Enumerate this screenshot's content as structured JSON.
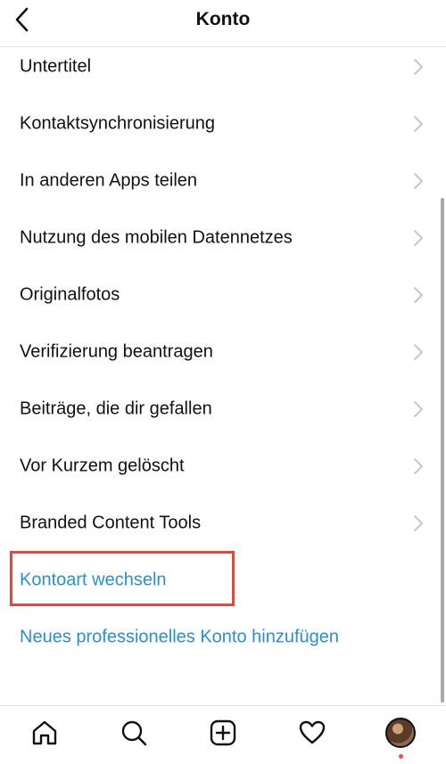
{
  "header": {
    "title": "Konto",
    "back_icon": "chevron-left-icon"
  },
  "settings": {
    "items": [
      {
        "label": "Untertitel"
      },
      {
        "label": "Kontaktsynchronisierung"
      },
      {
        "label": "In anderen Apps teilen"
      },
      {
        "label": "Nutzung des mobilen Datennetzes"
      },
      {
        "label": "Originalfotos"
      },
      {
        "label": "Verifizierung beantragen"
      },
      {
        "label": "Beiträge, die dir gefallen"
      },
      {
        "label": "Vor Kurzem gelöscht"
      },
      {
        "label": "Branded Content Tools"
      }
    ],
    "switch_account_type": "Kontoart wechseln",
    "add_professional_account": "Neues professionelles Konto hinzufügen"
  },
  "tabbar": {
    "icons": [
      "home-icon",
      "search-icon",
      "new-post-icon",
      "activity-heart-icon",
      "profile-avatar"
    ]
  },
  "colors": {
    "link": "#2a8fcc",
    "highlight": "#e0483e",
    "text": "#111111",
    "chevron": "#c7c7cc",
    "notification": "#ed4956"
  }
}
